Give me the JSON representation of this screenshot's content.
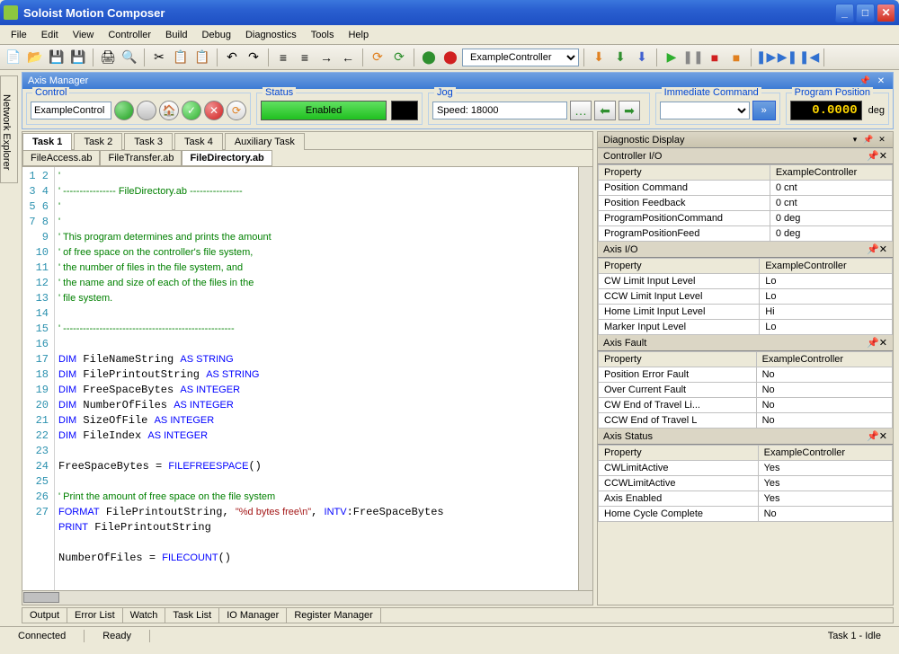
{
  "window": {
    "title": "Soloist Motion Composer"
  },
  "menu": [
    "File",
    "Edit",
    "View",
    "Controller",
    "Build",
    "Debug",
    "Diagnostics",
    "Tools",
    "Help"
  ],
  "toolbar": {
    "controller_combo": "ExampleController"
  },
  "sidetab": "Network Explorer",
  "axis": {
    "title": "Axis Manager",
    "control": {
      "label": "Control",
      "value": "ExampleControl"
    },
    "status": {
      "label": "Status",
      "value": "Enabled"
    },
    "jog": {
      "label": "Jog",
      "value": "Speed: 18000"
    },
    "imm": {
      "label": "Immediate Command"
    },
    "pos": {
      "label": "Program Position",
      "value": "0.0000",
      "unit": "deg"
    }
  },
  "tasks": [
    "Task 1",
    "Task 2",
    "Task 3",
    "Task 4",
    "Auxiliary Task"
  ],
  "filetabs": [
    "FileAccess.ab",
    "FileTransfer.ab",
    "FileDirectory.ab"
  ],
  "code_lines": [
    {
      "n": 1,
      "t": "'",
      "cls": "c-cm"
    },
    {
      "n": 2,
      "t": "' ---------------- FileDirectory.ab ----------------",
      "cls": "c-cm"
    },
    {
      "n": 3,
      "t": "'",
      "cls": "c-cm"
    },
    {
      "n": 4,
      "t": "'",
      "cls": "c-cm"
    },
    {
      "n": 5,
      "t": "' This program determines and prints the amount",
      "cls": "c-cm"
    },
    {
      "n": 6,
      "t": "' of free space on the controller's file system,",
      "cls": "c-cm"
    },
    {
      "n": 7,
      "t": "' the number of files in the file system, and",
      "cls": "c-cm"
    },
    {
      "n": 8,
      "t": "' the name and size of each of the files in the",
      "cls": "c-cm"
    },
    {
      "n": 9,
      "t": "' file system.",
      "cls": "c-cm"
    },
    {
      "n": 10,
      "t": "",
      "cls": ""
    },
    {
      "n": 11,
      "t": "' ----------------------------------------------------",
      "cls": "c-cm"
    },
    {
      "n": 12,
      "t": "",
      "cls": ""
    },
    {
      "n": 13,
      "html": "<span class=c-kw>DIM</span> FileNameString <span class=c-kw>AS STRING</span>"
    },
    {
      "n": 14,
      "html": "<span class=c-kw>DIM</span> FilePrintoutString <span class=c-kw>AS STRING</span>"
    },
    {
      "n": 15,
      "html": "<span class=c-kw>DIM</span> FreeSpaceBytes <span class=c-kw>AS INTEGER</span>"
    },
    {
      "n": 16,
      "html": "<span class=c-kw>DIM</span> NumberOfFiles <span class=c-kw>AS INTEGER</span>"
    },
    {
      "n": 17,
      "html": "<span class=c-kw>DIM</span> SizeOfFile <span class=c-kw>AS INTEGER</span>"
    },
    {
      "n": 18,
      "html": "<span class=c-kw>DIM</span> FileIndex <span class=c-kw>AS INTEGER</span>"
    },
    {
      "n": 19,
      "t": "",
      "cls": ""
    },
    {
      "n": 20,
      "html": "FreeSpaceBytes = <span class=c-kw>FILEFREESPACE</span>()"
    },
    {
      "n": 21,
      "t": "",
      "cls": ""
    },
    {
      "n": 22,
      "t": "' Print the amount of free space on the file system",
      "cls": "c-cm"
    },
    {
      "n": 23,
      "html": "<span class=c-kw>FORMAT</span> FilePrintoutString, <span class=c-str>\"%d bytes free\\n\"</span>, <span class=c-kw>INTV</span>:FreeSpaceBytes"
    },
    {
      "n": 24,
      "html": "<span class=c-kw>PRINT</span> FilePrintoutString"
    },
    {
      "n": 25,
      "t": "",
      "cls": ""
    },
    {
      "n": 26,
      "html": "NumberOfFiles = <span class=c-kw>FILECOUNT</span>()"
    },
    {
      "n": 27,
      "t": "",
      "cls": ""
    }
  ],
  "diag": {
    "title": "Diagnostic Display",
    "sections": [
      {
        "name": "Controller I/O",
        "heads": [
          "Property",
          "ExampleController"
        ],
        "rows": [
          [
            "Position Command",
            "0 cnt"
          ],
          [
            "Position Feedback",
            "0 cnt"
          ],
          [
            "ProgramPositionCommand",
            "0 deg"
          ],
          [
            "ProgramPositionFeed",
            "0 deg"
          ]
        ]
      },
      {
        "name": "Axis I/O",
        "heads": [
          "Property",
          "ExampleController"
        ],
        "rows": [
          [
            "CW Limit Input Level",
            "Lo"
          ],
          [
            "CCW Limit Input Level",
            "Lo"
          ],
          [
            "Home Limit Input Level",
            "Hi"
          ],
          [
            "Marker Input Level",
            "Lo"
          ]
        ]
      },
      {
        "name": "Axis Fault",
        "heads": [
          "Property",
          "ExampleController"
        ],
        "rows": [
          [
            "Position Error Fault",
            "No"
          ],
          [
            "Over Current Fault",
            "No"
          ],
          [
            "CW End of Travel Li...",
            "No"
          ],
          [
            "CCW End of Travel L",
            "No"
          ]
        ]
      },
      {
        "name": "Axis Status",
        "heads": [
          "Property",
          "ExampleController"
        ],
        "rows": [
          [
            "CWLimitActive",
            "Yes"
          ],
          [
            "CCWLimitActive",
            "Yes"
          ],
          [
            "Axis Enabled",
            "Yes"
          ],
          [
            "Home Cycle Complete",
            "No"
          ]
        ]
      }
    ]
  },
  "bottom_tabs": [
    "Output",
    "Error List",
    "Watch",
    "Task List",
    "IO Manager",
    "Register Manager"
  ],
  "status": {
    "conn": "Connected",
    "state": "Ready",
    "task": "Task 1 - Idle"
  }
}
